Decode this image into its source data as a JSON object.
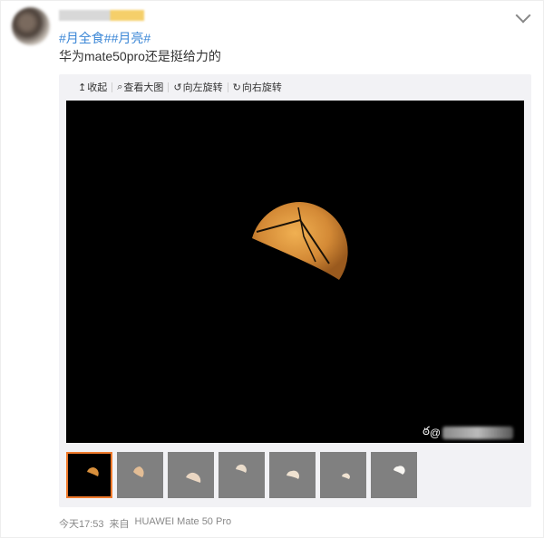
{
  "post": {
    "tags": [
      "#月全食#",
      "#月亮#"
    ],
    "text": "华为mate50pro还是挺给力的",
    "time": "今天17:53",
    "source_prefix": "来自",
    "source_device": "HUAWEI Mate 50 Pro"
  },
  "toolbar": {
    "collapse": {
      "icon": "↥",
      "label": "收起"
    },
    "view_large": {
      "icon": "⌕",
      "label": "查看大图"
    },
    "rotate_left": {
      "icon": "↺",
      "label": "向左旋转"
    },
    "rotate_right": {
      "icon": "↻",
      "label": "向右旋转"
    }
  },
  "watermark": {
    "icon": "ఠ",
    "at": "@"
  },
  "thumbnails": [
    {
      "active": true,
      "moon": "orange"
    },
    {
      "active": false,
      "moon": "peach"
    },
    {
      "active": false,
      "moon": "pale"
    },
    {
      "active": false,
      "moon": "pale"
    },
    {
      "active": false,
      "moon": "pale"
    },
    {
      "active": false,
      "moon": "pale"
    },
    {
      "active": false,
      "moon": "white"
    }
  ],
  "colors": {
    "link": "#3a86d6",
    "active_thumb_border": "#f07a2c",
    "moon": "#d9903c"
  }
}
